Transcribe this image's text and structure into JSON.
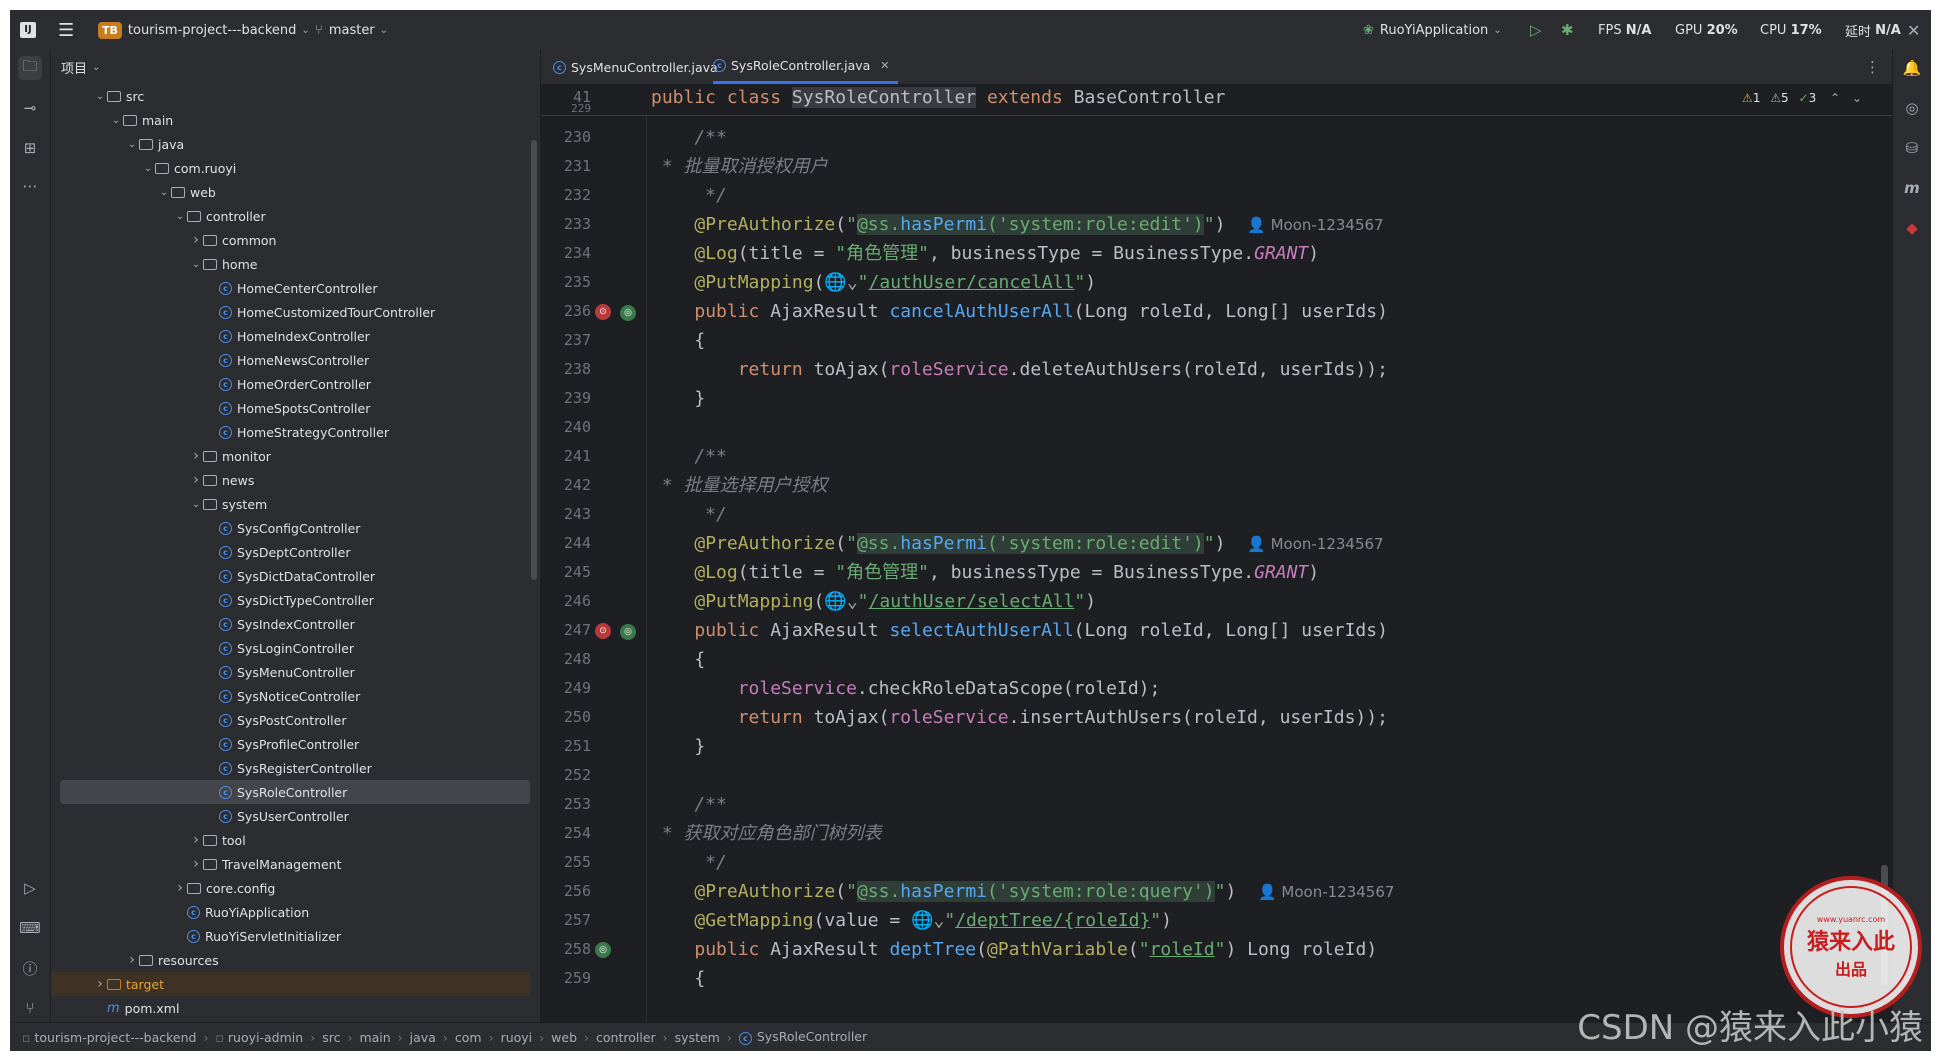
{
  "title_bar": {
    "project_badge": "TB",
    "project_name": "tourism-project---backend",
    "branch": "master",
    "run_config": "RuoYiApplication",
    "fps_label": "FPS",
    "fps_value": "N/A",
    "gpu_label": "GPU",
    "gpu_value": "20%",
    "cpu_label": "CPU",
    "cpu_value": "17%",
    "latency_label": "延时",
    "latency_value": "N/A"
  },
  "project_panel": {
    "title": "项目",
    "tree": [
      {
        "label": "src",
        "type": "folder",
        "depth": 0,
        "arrow": "down"
      },
      {
        "label": "main",
        "type": "folder",
        "depth": 1,
        "arrow": "down"
      },
      {
        "label": "java",
        "type": "folder",
        "depth": 2,
        "arrow": "down"
      },
      {
        "label": "com.ruoyi",
        "type": "folder",
        "depth": 3,
        "arrow": "down"
      },
      {
        "label": "web",
        "type": "folder",
        "depth": 4,
        "arrow": "down"
      },
      {
        "label": "controller",
        "type": "folder",
        "depth": 5,
        "arrow": "down"
      },
      {
        "label": "common",
        "type": "folder",
        "depth": 6,
        "arrow": "right"
      },
      {
        "label": "home",
        "type": "folder",
        "depth": 6,
        "arrow": "down"
      },
      {
        "label": "HomeCenterController",
        "type": "class",
        "depth": 7
      },
      {
        "label": "HomeCustomizedTourController",
        "type": "class",
        "depth": 7
      },
      {
        "label": "HomeIndexController",
        "type": "class",
        "depth": 7
      },
      {
        "label": "HomeNewsController",
        "type": "class",
        "depth": 7
      },
      {
        "label": "HomeOrderController",
        "type": "class",
        "depth": 7
      },
      {
        "label": "HomeSpotsController",
        "type": "class",
        "depth": 7
      },
      {
        "label": "HomeStrategyController",
        "type": "class",
        "depth": 7
      },
      {
        "label": "monitor",
        "type": "folder",
        "depth": 6,
        "arrow": "right"
      },
      {
        "label": "news",
        "type": "folder",
        "depth": 6,
        "arrow": "right"
      },
      {
        "label": "system",
        "type": "folder",
        "depth": 6,
        "arrow": "down"
      },
      {
        "label": "SysConfigController",
        "type": "class",
        "depth": 7
      },
      {
        "label": "SysDeptController",
        "type": "class",
        "depth": 7
      },
      {
        "label": "SysDictDataController",
        "type": "class",
        "depth": 7
      },
      {
        "label": "SysDictTypeController",
        "type": "class",
        "depth": 7
      },
      {
        "label": "SysIndexController",
        "type": "class",
        "depth": 7
      },
      {
        "label": "SysLoginController",
        "type": "class",
        "depth": 7
      },
      {
        "label": "SysMenuController",
        "type": "class",
        "depth": 7
      },
      {
        "label": "SysNoticeController",
        "type": "class",
        "depth": 7
      },
      {
        "label": "SysPostController",
        "type": "class",
        "depth": 7
      },
      {
        "label": "SysProfileController",
        "type": "class",
        "depth": 7
      },
      {
        "label": "SysRegisterController",
        "type": "class",
        "depth": 7
      },
      {
        "label": "SysRoleController",
        "type": "class",
        "depth": 7,
        "selected": true
      },
      {
        "label": "SysUserController",
        "type": "class",
        "depth": 7
      },
      {
        "label": "tool",
        "type": "folder",
        "depth": 6,
        "arrow": "right"
      },
      {
        "label": "TravelManagement",
        "type": "folder",
        "depth": 6,
        "arrow": "right"
      },
      {
        "label": "core.config",
        "type": "folder",
        "depth": 5,
        "arrow": "right"
      },
      {
        "label": "RuoYiApplication",
        "type": "class",
        "depth": 5
      },
      {
        "label": "RuoYiServletInitializer",
        "type": "class",
        "depth": 5
      },
      {
        "label": "resources",
        "type": "folder",
        "depth": 2,
        "arrow": "right"
      },
      {
        "label": "target",
        "type": "folder",
        "depth": 0,
        "arrow": "right",
        "target": true
      },
      {
        "label": "pom.xml",
        "type": "xml",
        "depth": 0
      }
    ]
  },
  "tabs": [
    {
      "label": "SysMenuController.java",
      "active": false
    },
    {
      "label": "SysRoleController.java",
      "active": true
    }
  ],
  "inspections": {
    "warnings": "1",
    "weak": "5",
    "ok": "3"
  },
  "editor": {
    "sticky_line_no": "41",
    "sticky_first_ln": "229",
    "sticky_code": "public class SysRoleController extends BaseController",
    "author": "Moon-1234567",
    "line_numbers": [
      "230",
      "231",
      "232",
      "233",
      "234",
      "235",
      "236",
      "237",
      "238",
      "239",
      "240",
      "241",
      "242",
      "243",
      "244",
      "245",
      "246",
      "247",
      "248",
      "249",
      "250",
      "251",
      "252",
      "253",
      "254",
      "255",
      "256",
      "257",
      "258",
      "259"
    ],
    "comment_1": " * 批量取消授权用户",
    "comment_2": " * 批量选择用户授权",
    "comment_3": " * 获取对应角色部门树列表",
    "role_name": "\"角色管理\"",
    "perm_edit": "'system:role:edit'",
    "perm_query": "'system:role:query'",
    "url_cancel": "/authUser/cancelAll",
    "url_select": "/authUser/selectAll",
    "url_dept": "/deptTree/{roleId}",
    "method_cancel": "cancelAuthUserAll",
    "method_select": "selectAuthUserAll",
    "method_dept": "deptTree",
    "path_var": "roleId"
  },
  "status_bar": {
    "crumbs": [
      "tourism-project---backend",
      "ruoyi-admin",
      "src",
      "main",
      "java",
      "com",
      "ruoyi",
      "web",
      "controller",
      "system",
      "SysRoleController"
    ]
  },
  "watermark": "CSDN @猿来入此小猿",
  "seal_text": "猿来入此",
  "seal_sub": "出品",
  "seal_url": "www.yuanrc.com"
}
